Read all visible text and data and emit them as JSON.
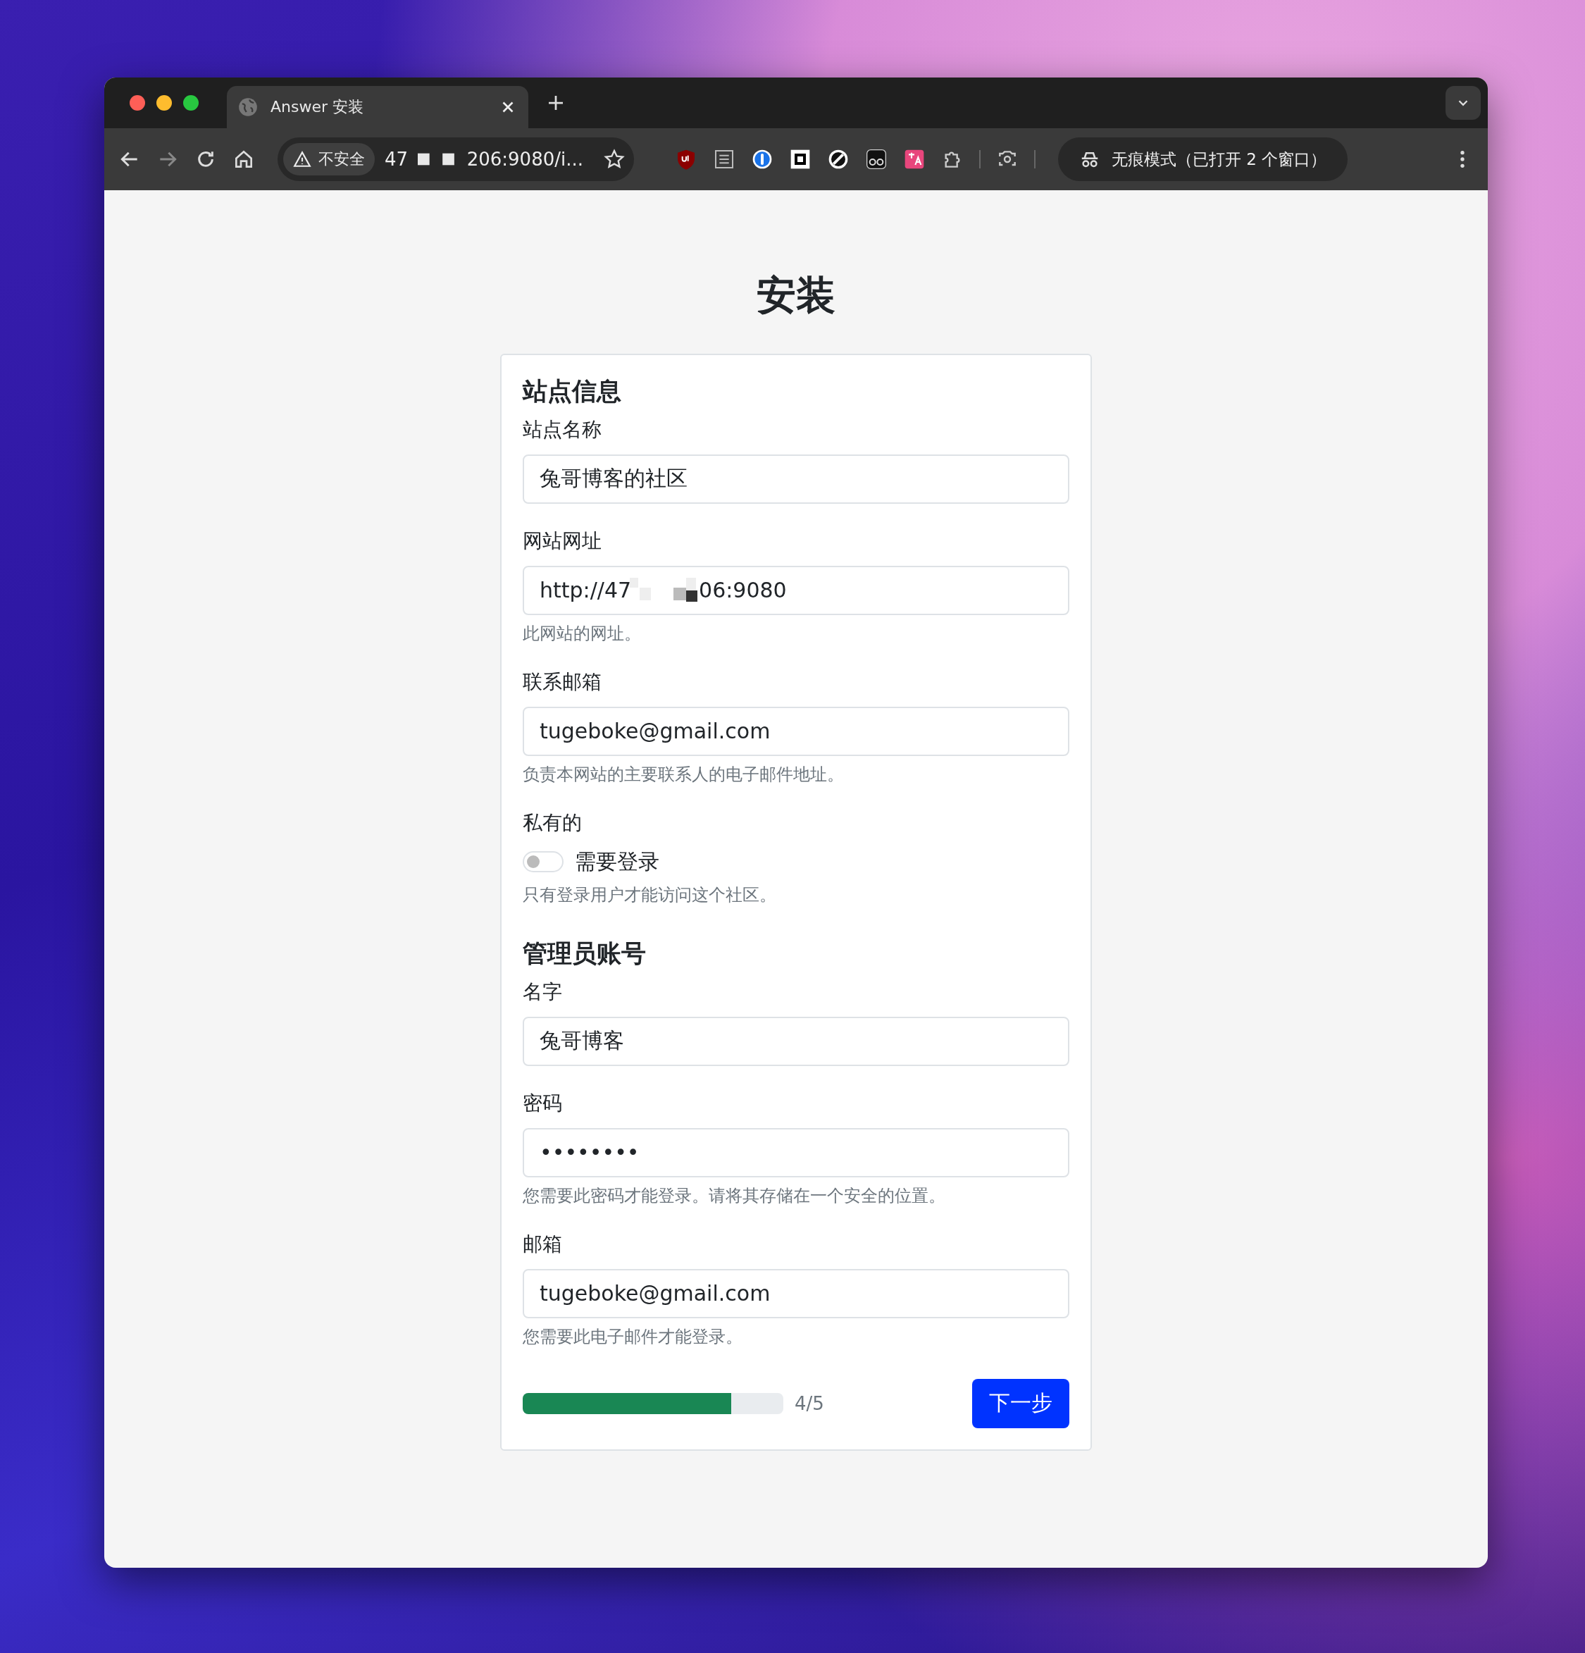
{
  "browser": {
    "tab": {
      "title": "Answer 安装"
    },
    "address": {
      "security": "不安全",
      "url_start": "47",
      "url_end": "206:9080/i..."
    },
    "profile": "无痕模式（已打开 2 个窗口）"
  },
  "page": {
    "title": "安装",
    "sections": [
      {
        "heading": "站点信息",
        "fields": [
          {
            "kind": "text",
            "label": "站点名称",
            "value": "兔哥博客的社区"
          },
          {
            "kind": "redacted",
            "label": "网站网址",
            "value_start": "http://47",
            "value_end": "06:9080",
            "help": "此网站的网址。"
          },
          {
            "kind": "text",
            "label": "联系邮箱",
            "value": "tugeboke@gmail.com",
            "help": "负责本网站的主要联系人的电子邮件地址。"
          },
          {
            "kind": "switch",
            "label": "私有的",
            "switch_label": "需要登录",
            "on": false,
            "help": "只有登录用户才能访问这个社区。"
          }
        ]
      },
      {
        "heading": "管理员账号",
        "fields": [
          {
            "kind": "text",
            "label": "名字",
            "value": "兔哥博客"
          },
          {
            "kind": "password",
            "label": "密码",
            "value": "••••••••",
            "help": "您需要此密码才能登录。请将其存储在一个安全的位置。"
          },
          {
            "kind": "text",
            "label": "邮箱",
            "value": "tugeboke@gmail.com",
            "help": "您需要此电子邮件才能登录。"
          }
        ]
      }
    ],
    "progress": {
      "level": 0.8,
      "reading": "4/5"
    },
    "next_button": "下一步"
  }
}
